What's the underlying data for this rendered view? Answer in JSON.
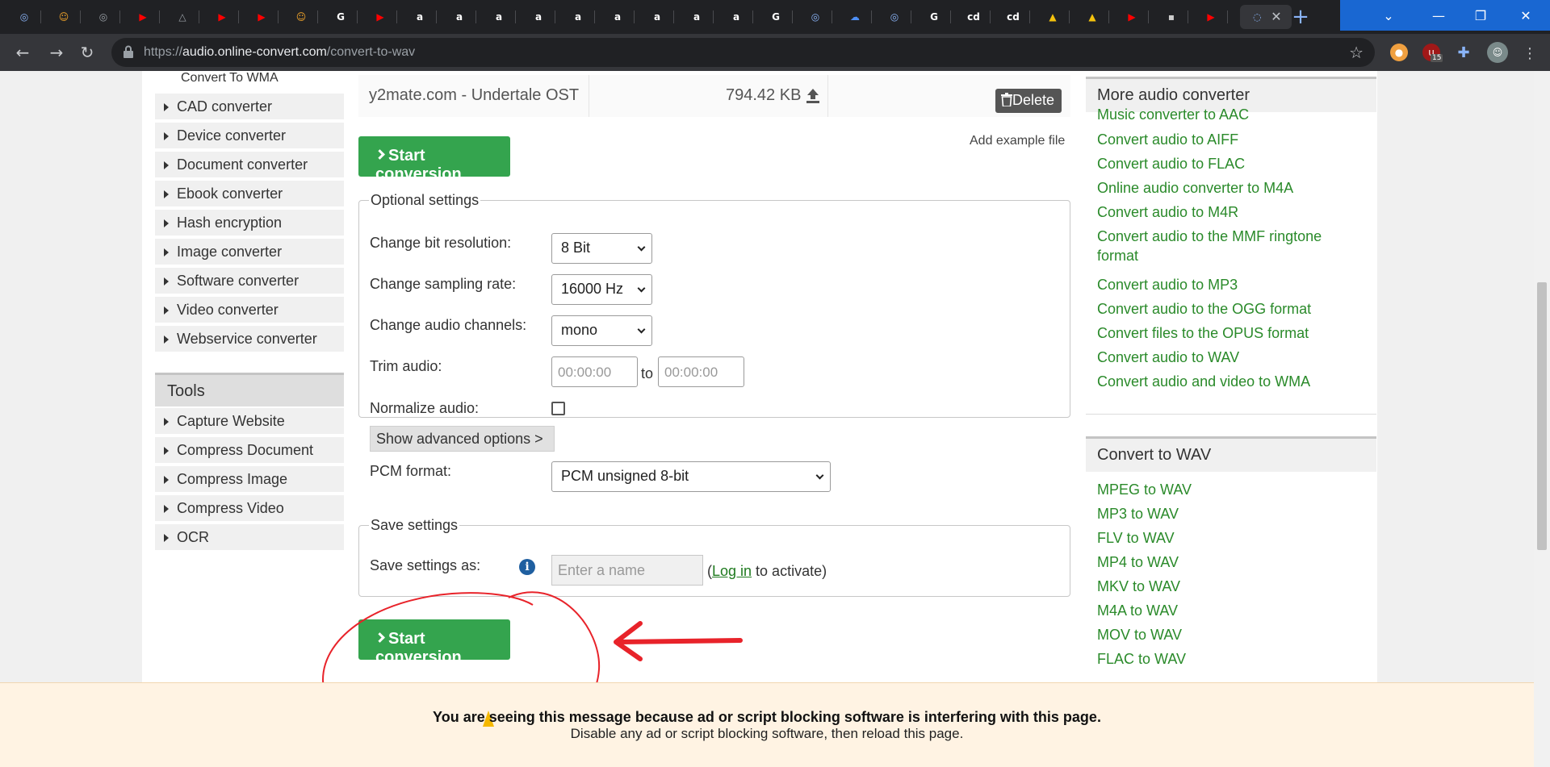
{
  "browser": {
    "tabs": [
      {
        "icon": "chrome-icon",
        "color": "#8ab4f8",
        "glyph": "◎"
      },
      {
        "icon": "avatar-icon",
        "color": "#f4a62a",
        "glyph": "☺"
      },
      {
        "icon": "chrome-icon",
        "color": "#9aa0a6",
        "glyph": "◎"
      },
      {
        "icon": "youtube-icon",
        "color": "#ff0000",
        "glyph": "▶"
      },
      {
        "icon": "drive-icon",
        "color": "#9aa0a6",
        "glyph": "△"
      },
      {
        "icon": "youtube-icon",
        "color": "#ff0000",
        "glyph": "▶"
      },
      {
        "icon": "youtube-icon",
        "color": "#ff0000",
        "glyph": "▶"
      },
      {
        "icon": "avatar-icon",
        "color": "#f4a62a",
        "glyph": "☺"
      },
      {
        "icon": "google-icon",
        "color": "#ffffff",
        "glyph": "G"
      },
      {
        "icon": "youtube-icon",
        "color": "#ff0000",
        "glyph": "▶"
      },
      {
        "icon": "amazon-icon",
        "color": "#ffffff",
        "glyph": "a"
      },
      {
        "icon": "amazon-icon",
        "color": "#ffffff",
        "glyph": "a"
      },
      {
        "icon": "amazon-icon",
        "color": "#ffffff",
        "glyph": "a"
      },
      {
        "icon": "amazon-icon",
        "color": "#ffffff",
        "glyph": "a"
      },
      {
        "icon": "amazon-icon",
        "color": "#ffffff",
        "glyph": "a"
      },
      {
        "icon": "amazon-icon",
        "color": "#ffffff",
        "glyph": "a"
      },
      {
        "icon": "amazon-icon",
        "color": "#ffffff",
        "glyph": "a"
      },
      {
        "icon": "amazon-icon",
        "color": "#ffffff",
        "glyph": "a"
      },
      {
        "icon": "amazon-icon",
        "color": "#ffffff",
        "glyph": "a"
      },
      {
        "icon": "google-icon",
        "color": "#ffffff",
        "glyph": "G"
      },
      {
        "icon": "chrome-icon",
        "color": "#8ab4f8",
        "glyph": "◎"
      },
      {
        "icon": "cloud-icon",
        "color": "#4d8ff5",
        "glyph": "☁"
      },
      {
        "icon": "chrome-icon",
        "color": "#8ab4f8",
        "glyph": "◎"
      },
      {
        "icon": "google-icon",
        "color": "#ffffff",
        "glyph": "G"
      },
      {
        "icon": "cd-icon",
        "color": "#ffffff",
        "glyph": "cd"
      },
      {
        "icon": "cd-icon",
        "color": "#ffffff",
        "glyph": "cd"
      },
      {
        "icon": "drive-icon",
        "color": "#f4c20d",
        "glyph": "▲"
      },
      {
        "icon": "drive-icon",
        "color": "#f4c20d",
        "glyph": "▲"
      },
      {
        "icon": "youtube-icon",
        "color": "#ff0000",
        "glyph": "▶"
      },
      {
        "icon": "app-icon",
        "color": "#cccccc",
        "glyph": "▪"
      },
      {
        "icon": "youtube-icon",
        "color": "#ff0000",
        "glyph": "▶"
      }
    ],
    "url_host": "audio.online-convert.com",
    "url_scheme": "https://",
    "url_path": "/convert-to-wav",
    "ext_badge": "15"
  },
  "sidebar": {
    "sub_item": "Convert To WMA",
    "items": [
      "CAD converter",
      "Device converter",
      "Document converter",
      "Ebook converter",
      "Hash encryption",
      "Image converter",
      "Software converter",
      "Video converter",
      "Webservice converter"
    ],
    "tools_heading": "Tools",
    "tools": [
      "Capture Website",
      "Compress Document",
      "Compress Image",
      "Compress Video",
      "OCR"
    ]
  },
  "file": {
    "name": "y2mate.com - Undertale OST",
    "size": "794.42 KB",
    "delete_label": "Delete"
  },
  "main": {
    "start_label": "Start conversion",
    "add_example": "Add example file",
    "optional_legend": "Optional settings",
    "bit_label": "Change bit resolution:",
    "bit_value": "8 Bit",
    "rate_label": "Change sampling rate:",
    "rate_value": "16000 Hz",
    "channels_label": "Change audio channels:",
    "channels_value": "mono",
    "trim_label": "Trim audio:",
    "trim_from_placeholder": "00:00:00",
    "trim_to_label": "to",
    "trim_to_placeholder": "00:00:00",
    "normalize_label": "Normalize audio:",
    "advanced_label": "Show advanced options >",
    "pcm_label": "PCM format:",
    "pcm_value": "PCM unsigned 8-bit",
    "save_legend": "Save settings",
    "save_as_label": "Save settings as:",
    "name_placeholder": "Enter a name",
    "login_open": "(",
    "login_link": "Log in",
    "login_rest": " to activate)"
  },
  "right": {
    "more_heading": "More audio converter",
    "more_links": [
      "Music converter to AAC",
      "Convert audio to AIFF",
      "Convert audio to FLAC",
      "Online audio converter to M4A",
      "Convert audio to M4R",
      "Convert audio to the MMF ringtone format",
      "Convert audio to MP3",
      "Convert audio to the OGG format",
      "Convert files to the OPUS format",
      "Convert audio to WAV",
      "Convert audio and video to WMA"
    ],
    "wav_heading": "Convert to WAV",
    "wav_links": [
      "MPEG to WAV",
      "MP3 to WAV",
      "FLV to WAV",
      "MP4 to WAV",
      "MKV to WAV",
      "M4A to WAV",
      "MOV to WAV",
      "FLAC to WAV"
    ]
  },
  "adblock": {
    "line1": "You are seeing this message because ad or script blocking software is interfering with this page.",
    "line2": "Disable any ad or script blocking software, then reload this page."
  },
  "colors": {
    "accent_green": "#34a44e",
    "link_green": "#2a8a2a",
    "annotation_red": "#e8232a"
  }
}
